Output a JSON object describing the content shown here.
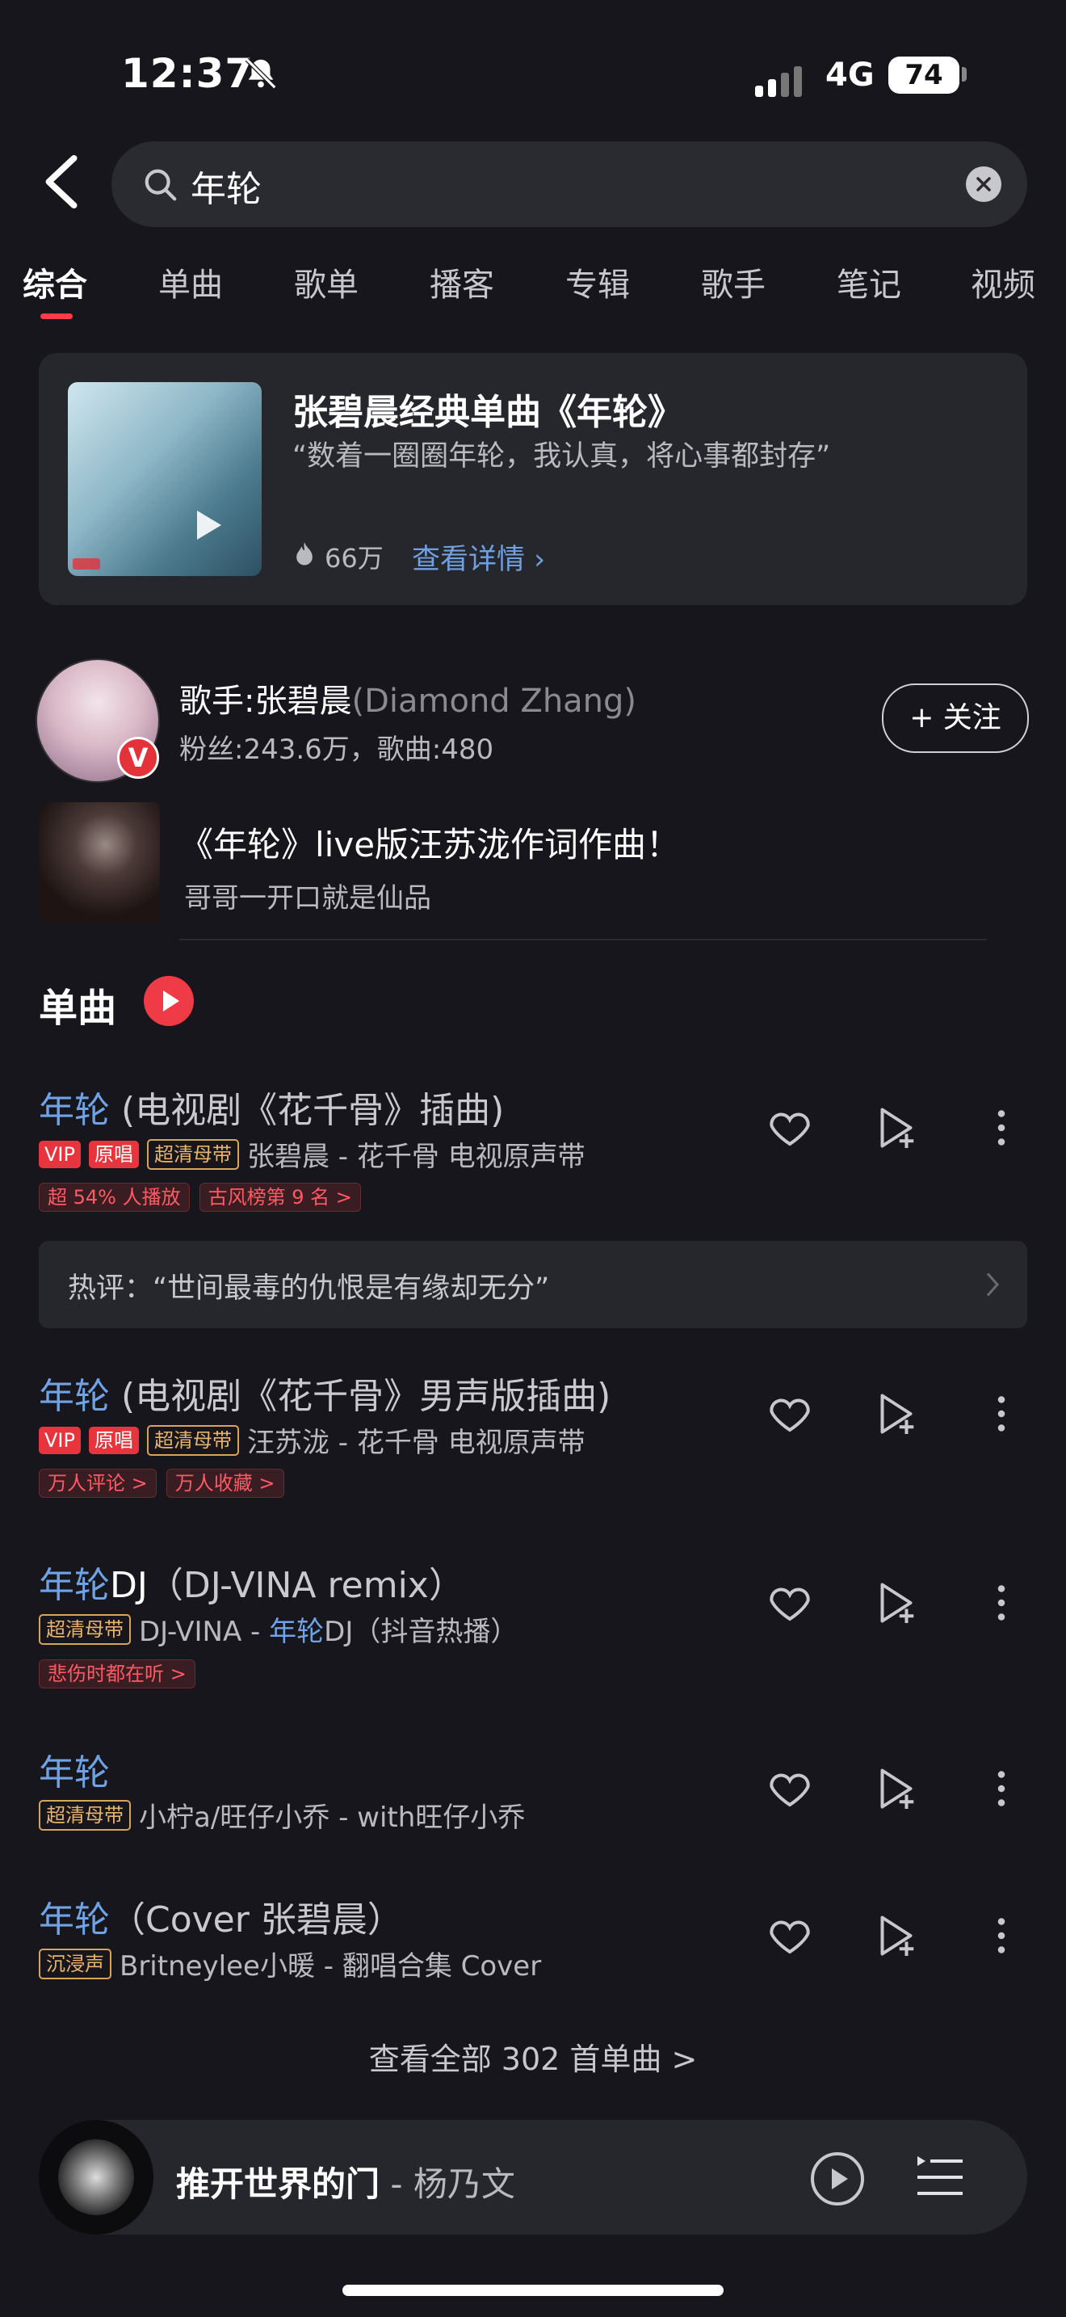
{
  "status_bar": {
    "time": "12:37",
    "network": "4G",
    "battery": "74"
  },
  "search": {
    "query": "年轮"
  },
  "tabs": [
    {
      "label": "综合",
      "active": true
    },
    {
      "label": "单曲"
    },
    {
      "label": "歌单"
    },
    {
      "label": "播客"
    },
    {
      "label": "专辑"
    },
    {
      "label": "歌手"
    },
    {
      "label": "笔记"
    },
    {
      "label": "视频"
    }
  ],
  "featured": {
    "title": "张碧晨经典单曲《年轮》",
    "quote": "“数着一圈圈年轮，我认真，将心事都封存”",
    "hot_count": "66万",
    "detail_link": "查看详情"
  },
  "artist": {
    "name": "歌手:张碧晨",
    "name_en": "(Diamond Zhang)",
    "stats": "粉丝:243.6万，歌曲:480",
    "follow_label": "+ 关注",
    "badge": "V"
  },
  "live": {
    "title": "《年轮》live版汪苏泷作词作曲！",
    "subtitle": "哥哥一开口就是仙品"
  },
  "songs_section": {
    "title": "单曲"
  },
  "songs": [
    {
      "title_hl": "年轮",
      "title_rest": " (电视剧《花千骨》插曲)",
      "tags": [
        "VIP",
        "原唱",
        "超清母带"
      ],
      "meta": "张碧晨 - 花千骨 电视原声带",
      "chips": [
        "超 54% 人播放",
        "古风榜第 9 名 >"
      ]
    },
    {
      "title_hl": "年轮",
      "title_rest": " (电视剧《花千骨》男声版插曲)",
      "tags": [
        "VIP",
        "原唱",
        "超清母带"
      ],
      "meta": "汪苏泷 - 花千骨 电视原声带",
      "chips": [
        "万人评论 >",
        "万人收藏 >"
      ]
    },
    {
      "title_hl": "年轮",
      "title_strong": "DJ",
      "title_rest": "（DJ-VINA remix）",
      "tags": [
        "超清母带"
      ],
      "meta_pre": "DJ-VINA - ",
      "meta_hl": "年轮",
      "meta_post": "DJ（抖音热播）",
      "chips": [
        "悲伤时都在听 >"
      ]
    },
    {
      "title_hl": "年轮",
      "title_rest": "",
      "tags": [
        "超清母带"
      ],
      "meta": "小柠a/旺仔小乔 - with旺仔小乔"
    },
    {
      "title_hl": "年轮",
      "title_rest": "（Cover 张碧晨）",
      "tags": [
        "沉浸声"
      ],
      "meta": "Britneylee小暖 - 翻唱合集 Cover"
    }
  ],
  "hot_comment": "热评：“世间最毒的仇恨是有缘却无分”",
  "view_all": "查看全部 302 首单曲 >",
  "player": {
    "title": "推开世界的门",
    "artist": " - 杨乃文"
  },
  "colors": {
    "accent_red": "#ef3b45",
    "link_blue": "#6fa3e6",
    "background": "#16161c"
  }
}
